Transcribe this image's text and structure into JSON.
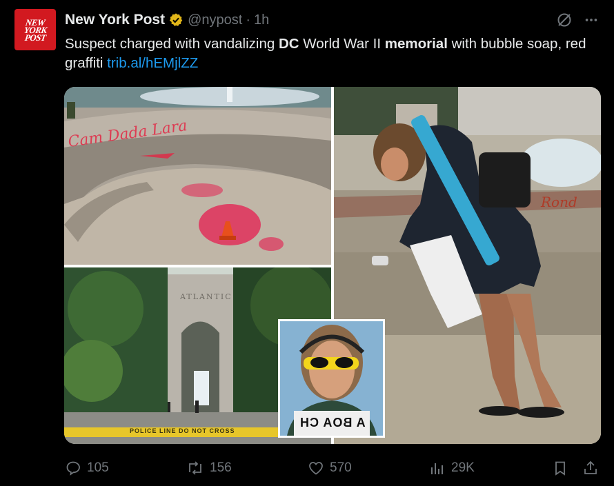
{
  "account": {
    "avatar_lines": [
      "NEW",
      "YORK",
      "POST"
    ],
    "name": "New York Post",
    "handle": "@nypost",
    "separator": "·",
    "time": "1h"
  },
  "tweet": {
    "text_1": "Suspect charged with vandalizing ",
    "bold_1": "DC",
    "text_2": " World War II ",
    "bold_2": "memorial",
    "text_3": " with bubble soap, red graffiti ",
    "link": "trib.al/hEMjlZZ"
  },
  "media": {
    "panel1_graffiti": "Cam Dada Lara",
    "panel2_inscription": "ATLANTIC",
    "panel2_tape": "POLICE LINE DO NOT CROSS",
    "panel3_graffiti": "Rond",
    "inset_shirt_text": "A BOA CH"
  },
  "metrics": {
    "replies": "105",
    "reposts": "156",
    "likes": "570",
    "views": "29K"
  },
  "icons": {
    "verified": "verified-badge-icon",
    "grok": "grok-icon",
    "more": "more-icon",
    "reply": "reply-icon",
    "repost": "repost-icon",
    "like": "like-icon",
    "views": "views-icon",
    "bookmark": "bookmark-icon",
    "share": "share-icon"
  },
  "colors": {
    "background": "#000000",
    "text": "#e7e9ea",
    "muted": "#71767b",
    "link": "#1d9bf0",
    "brand_red": "#d21920",
    "verified_gold": "#e2b719"
  }
}
